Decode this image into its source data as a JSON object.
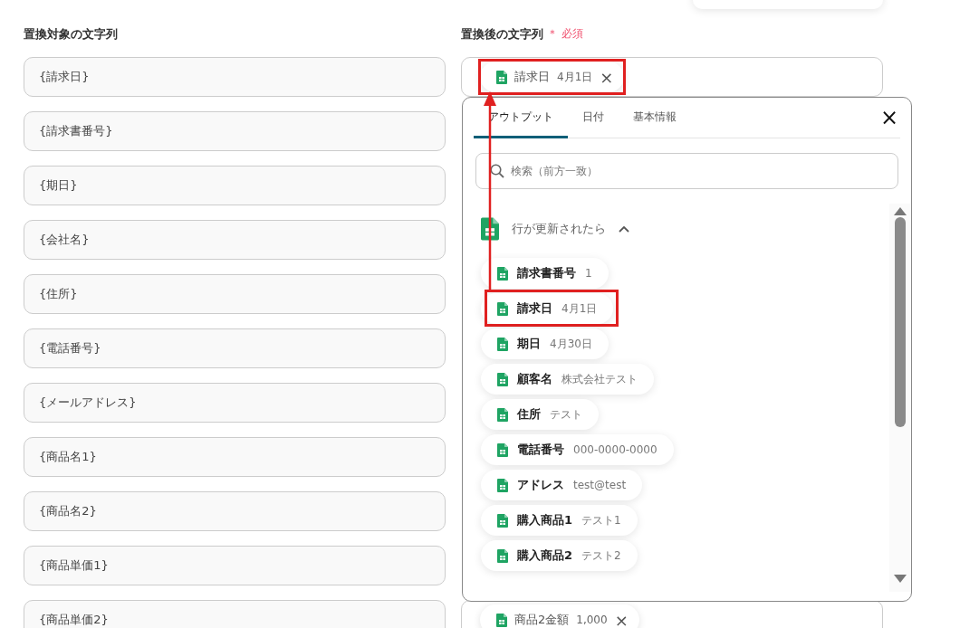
{
  "source_label": "置換対象の文字列",
  "target_label": "置換後の文字列",
  "required_mark": "＊",
  "required_text": "必須",
  "source_fields": [
    {
      "value": "{請求日}"
    },
    {
      "value": "{請求書番号}"
    },
    {
      "value": "{期日}"
    },
    {
      "value": "{会社名}"
    },
    {
      "value": "{住所}"
    },
    {
      "value": "{電話番号}"
    },
    {
      "value": "{メールアドレス}"
    },
    {
      "value": "{商品名1}"
    },
    {
      "value": "{商品名2}"
    },
    {
      "value": "{商品単価1}"
    },
    {
      "value": "{商品単価2}"
    }
  ],
  "target_fields": [
    {
      "chip": {
        "name": "請求日",
        "value": "4月1日",
        "remove": "×",
        "highlighted": true
      }
    },
    {
      "chip": {
        "name": "商品2金額",
        "value": "1,000",
        "remove": "×",
        "highlighted": false
      }
    }
  ],
  "picker": {
    "tabs": [
      {
        "label": "アウトプット",
        "selected": true
      },
      {
        "label": "日付",
        "selected": false
      },
      {
        "label": "基本情報",
        "selected": false
      }
    ],
    "close": "×",
    "search": {
      "placeholder": "検索（前方一致）"
    },
    "group": {
      "title": "行が更新されたら",
      "expanded": true,
      "items": [
        {
          "name": "請求書番号",
          "value": "1",
          "highlighted": false
        },
        {
          "name": "請求日",
          "value": "4月1日",
          "highlighted": true
        },
        {
          "name": "期日",
          "value": "4月30日",
          "highlighted": false
        },
        {
          "name": "顧客名",
          "value": "株式会社テスト",
          "highlighted": false
        },
        {
          "name": "住所",
          "value": "テスト",
          "highlighted": false
        },
        {
          "name": "電話番号",
          "value": "000-0000-0000",
          "highlighted": false
        },
        {
          "name": "アドレス",
          "value": "test@test",
          "highlighted": false
        },
        {
          "name": "購入商品1",
          "value": "テスト1",
          "highlighted": false
        },
        {
          "name": "購入商品2",
          "value": "テスト2",
          "highlighted": false
        }
      ]
    }
  },
  "annotation_arrow": true
}
